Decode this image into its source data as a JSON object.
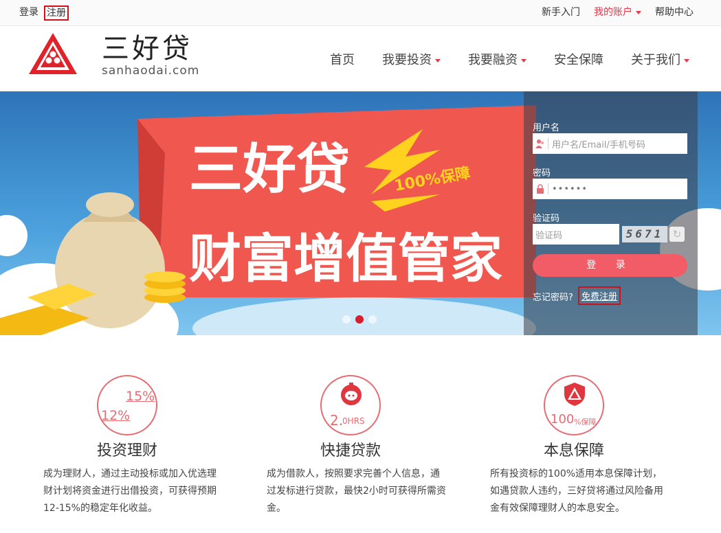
{
  "topbar": {
    "login": "登录",
    "register": "注册",
    "newbie": "新手入门",
    "my_account": "我的账户",
    "help": "帮助中心"
  },
  "header": {
    "logo_cn": "三好贷",
    "logo_en": "sanhaodai.com",
    "nav": [
      "首页",
      "我要投资",
      "我要融资",
      "安全保障",
      "关于我们"
    ]
  },
  "banner": {
    "headline_1": "三好贷",
    "headline_2": "财富增值管家",
    "tag": "100%保障"
  },
  "login_panel": {
    "username_label": "用户名",
    "username_placeholder": "用户名/Email/手机号码",
    "password_label": "密码",
    "password_value": "••••••",
    "captcha_label": "验证码",
    "captcha_placeholder": "验证码",
    "captcha_code": "5671",
    "login_button": "登 录",
    "forgot": "忘记密码?",
    "free_register": "免费注册"
  },
  "features": [
    {
      "title": "投资理财",
      "rate_low": "12%",
      "rate_high": "15%",
      "desc": "成为理财人，通过主动投标或加入优选理财计划将资金进行出借投资，可获得预期12-15%的稳定年化收益。"
    },
    {
      "title": "快捷贷款",
      "badge_num": "2.",
      "badge_sub": "0HRS",
      "desc": "成为借款人，按照要求完善个人信息，通过发标进行贷款，最快2小时可获得所需资金。"
    },
    {
      "title": "本息保障",
      "badge_num": "100",
      "badge_sub": "%保障",
      "desc": "所有投资标的100%适用本息保障计划，如遇贷款人违约，三好贷将通过风险备用金有效保障理财人的本息安全。"
    }
  ],
  "colors": {
    "brand_red": "#e33a4a",
    "button_pink": "#f25c66",
    "banner_blue": "#2e74b8"
  }
}
